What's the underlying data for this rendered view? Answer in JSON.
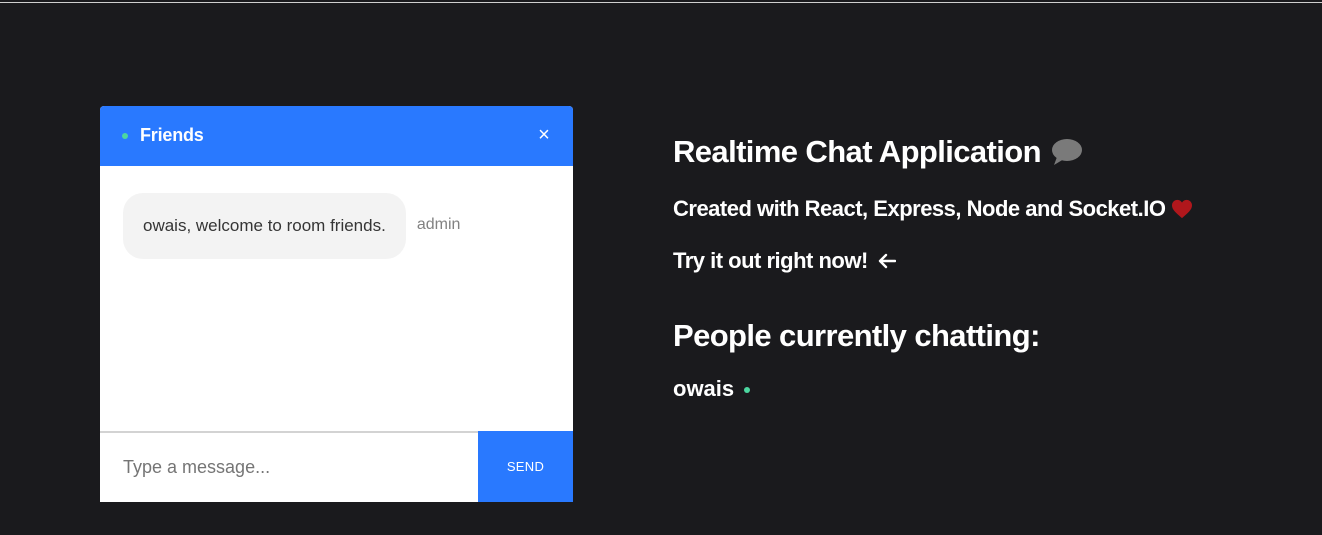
{
  "chat": {
    "room_name": "Friends",
    "close_label": "×",
    "messages": [
      {
        "text": "owais, welcome to room friends.",
        "sender": "admin"
      }
    ],
    "input_placeholder": "Type a message...",
    "input_value": "",
    "send_label": "SEND",
    "accent_color": "#2979ff",
    "online_color": "#4cd7a0"
  },
  "info": {
    "title": "Realtime Chat Application",
    "title_icon": "speech-bubble-icon",
    "subtitle": "Created with React, Express, Node and Socket.IO",
    "subtitle_icon": "heart-icon",
    "cta": "Try it out right now!",
    "cta_icon": "arrow-left-icon",
    "people_heading": "People currently chatting:",
    "people": [
      "owais"
    ]
  },
  "colors": {
    "background": "#1a1a1d",
    "heart": "#b0171c",
    "speech_bubble": "#7a7a7a"
  }
}
